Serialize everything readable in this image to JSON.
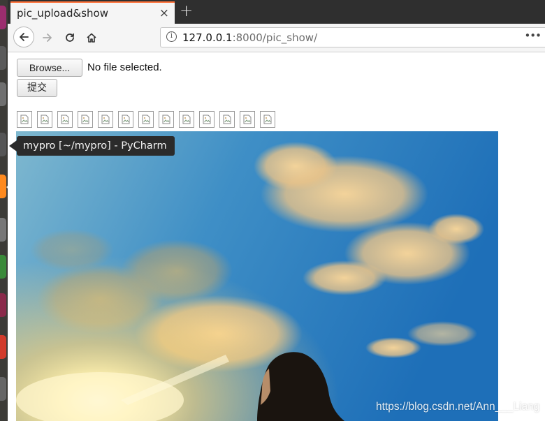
{
  "browser": {
    "tab_title": "pic_upload&show",
    "tab_close": "×",
    "new_tab": "+",
    "url_host": "127.0.0.1",
    "url_rest": ":8000/pic_show/",
    "url_info": "i",
    "more": "•••"
  },
  "page": {
    "browse_label": "Browse...",
    "file_status": "No file selected.",
    "submit_label": "提交",
    "thumbnail_count": 13
  },
  "launcher": {
    "tooltip": "mypro [~/mypro] - PyCharm",
    "item_colors": [
      "#9b2d6e",
      "#5a5a5a",
      "#6f6f6f",
      "#ff8a1e",
      "#777777",
      "#3a8a3a",
      "#8a2a4a",
      "#d23b2b",
      "#666666"
    ]
  },
  "watermark": "https://blog.csdn.net/Ann___Liang"
}
